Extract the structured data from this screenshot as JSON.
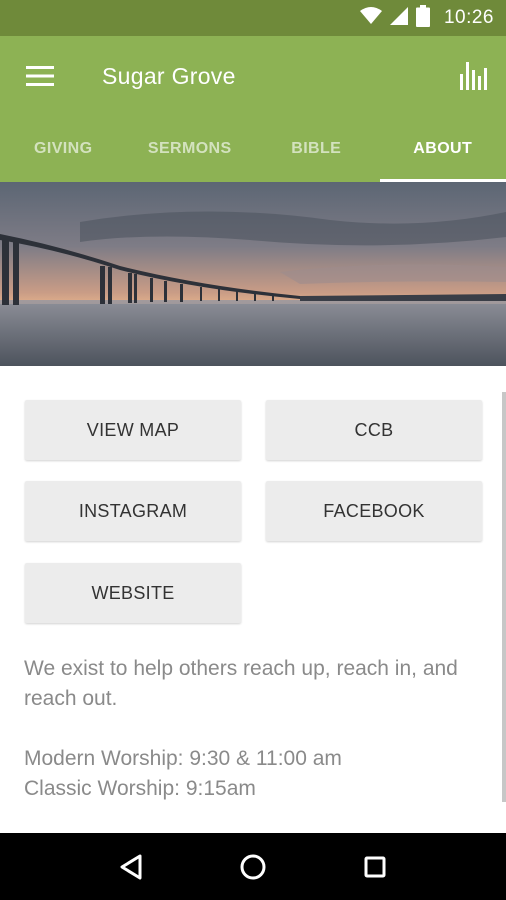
{
  "status_bar": {
    "time": "10:26",
    "icons": [
      "wifi-icon",
      "signal-icon",
      "battery-icon"
    ]
  },
  "app_bar": {
    "title": "Sugar Grove",
    "left_icon": "menu-icon",
    "right_icon": "bar-chart-icon"
  },
  "tabs": [
    {
      "label": "GIVING",
      "active": false
    },
    {
      "label": "SERMONS",
      "active": false
    },
    {
      "label": "BIBLE",
      "active": false
    },
    {
      "label": "ABOUT",
      "active": true
    }
  ],
  "hero": {
    "description": "bridge-over-water-at-sunset"
  },
  "buttons": {
    "view_map": "VIEW MAP",
    "ccb": "CCB",
    "instagram": "INSTAGRAM",
    "facebook": "FACEBOOK",
    "website": "WEBSITE"
  },
  "about": {
    "description": "We exist to help others reach up, reach in, and reach out.",
    "worship_modern": "Modern Worship: 9:30 & 11:00 am",
    "worship_classic": "Classic Worship: 9:15am"
  },
  "nav_bar": {
    "icons": [
      "back-icon",
      "home-icon",
      "recents-icon"
    ]
  },
  "colors": {
    "status_bar": "#6f8a3a",
    "primary": "#8db254",
    "button_bg": "#ececec",
    "text_muted": "#8a8a8a"
  }
}
